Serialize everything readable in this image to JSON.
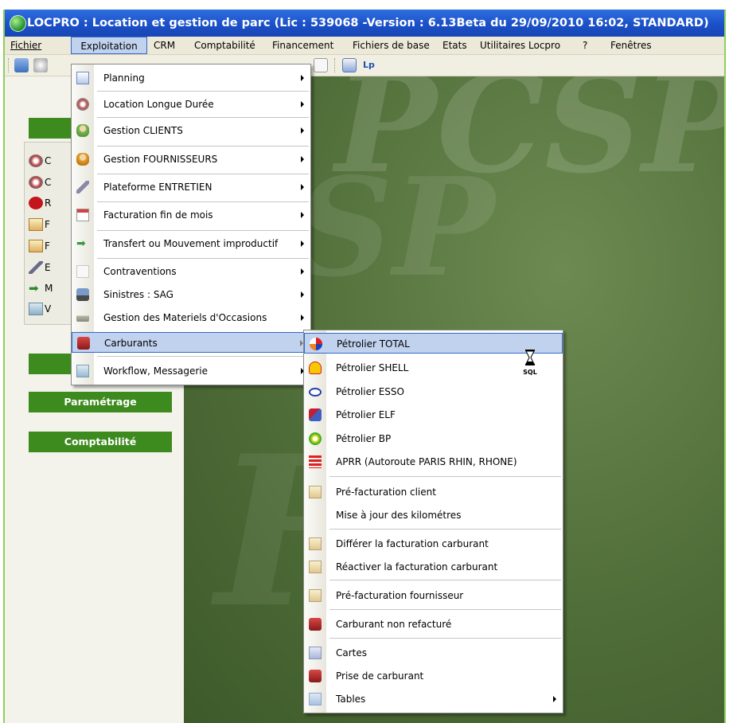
{
  "window": {
    "title": "LOCPRO : Location et gestion de parc (Lic : 539068 -Version : 6.13Beta du 29/09/2010 16:02, STANDARD)",
    "accent_color": "#3d8a1e"
  },
  "menubar": {
    "items": [
      {
        "label": "Fichier"
      },
      {
        "label": "Exploitation"
      },
      {
        "label": "CRM"
      },
      {
        "label": "Comptabilité"
      },
      {
        "label": "Financement"
      },
      {
        "label": "Fichiers de base"
      },
      {
        "label": "Etats"
      },
      {
        "label": "Utilitaires Locpro"
      },
      {
        "label": "?"
      },
      {
        "label": "Fenêtres"
      }
    ]
  },
  "left_panel": {
    "sections": [
      {
        "label": ""
      },
      {
        "label": "Paramétrage"
      },
      {
        "label": "Comptabilité"
      }
    ],
    "nav_letters": [
      "C",
      "C",
      "R",
      "F",
      "F",
      "E",
      "M",
      "V"
    ]
  },
  "exploitation_menu": {
    "items": [
      {
        "label": "Planning",
        "icon": "calendar-icon",
        "submenu": true
      },
      {
        "label": "Location Longue Durée",
        "icon": "disc-icon",
        "submenu": true
      },
      {
        "label": "Gestion CLIENTS",
        "icon": "people-icon",
        "submenu": true
      },
      {
        "label": "Gestion FOURNISSEURS",
        "icon": "people-orange-icon",
        "submenu": true
      },
      {
        "label": "Plateforme ENTRETIEN",
        "icon": "wrench-icon",
        "submenu": true
      },
      {
        "label": "Facturation fin de mois",
        "icon": "calendar-page-icon",
        "submenu": true
      },
      {
        "label": "Transfert ou Mouvement improductif",
        "icon": "arrow-right-icon",
        "submenu": true
      },
      {
        "label": "Contraventions",
        "icon": "document-icon",
        "submenu": true
      },
      {
        "label": "Sinistres : SAG",
        "icon": "tow-truck-icon",
        "submenu": true
      },
      {
        "label": "Gestion des Materiels d'Occasions",
        "icon": "car-icon",
        "submenu": true
      },
      {
        "label": "Carburants",
        "icon": "fuel-can-icon",
        "submenu": true
      },
      {
        "label": "Workflow, Messagerie",
        "icon": "map-icon",
        "submenu": true
      }
    ]
  },
  "carburants_menu": {
    "items": [
      {
        "label": "Pétrolier TOTAL",
        "icon": "total-logo-icon"
      },
      {
        "label": "Pétrolier SHELL",
        "icon": "shell-logo-icon"
      },
      {
        "label": "Pétrolier ESSO",
        "icon": "esso-logo-icon"
      },
      {
        "label": "Pétrolier ELF",
        "icon": "elf-logo-icon"
      },
      {
        "label": "Pétrolier BP",
        "icon": "bp-logo-icon"
      },
      {
        "label": "APRR (Autoroute PARIS RHIN, RHONE)",
        "icon": "aprr-logo-icon"
      },
      {
        "label": "Pré-facturation client",
        "icon": "document-icon"
      },
      {
        "label": "Mise à jour des kilométres",
        "icon": ""
      },
      {
        "label": "Différer la facturation carburant",
        "icon": "document-icon"
      },
      {
        "label": "Réactiver la facturation carburant",
        "icon": "document-icon"
      },
      {
        "label": "Pré-facturation fournisseur",
        "icon": "document-icon"
      },
      {
        "label": "Carburant non refacturé",
        "icon": "fuel-can-icon"
      },
      {
        "label": "Cartes",
        "icon": "card-icon"
      },
      {
        "label": "Prise de carburant",
        "icon": "fuel-can-icon"
      },
      {
        "label": "Tables",
        "icon": "table-icon",
        "submenu": true
      }
    ]
  },
  "cursor": {
    "label": "SQL"
  }
}
